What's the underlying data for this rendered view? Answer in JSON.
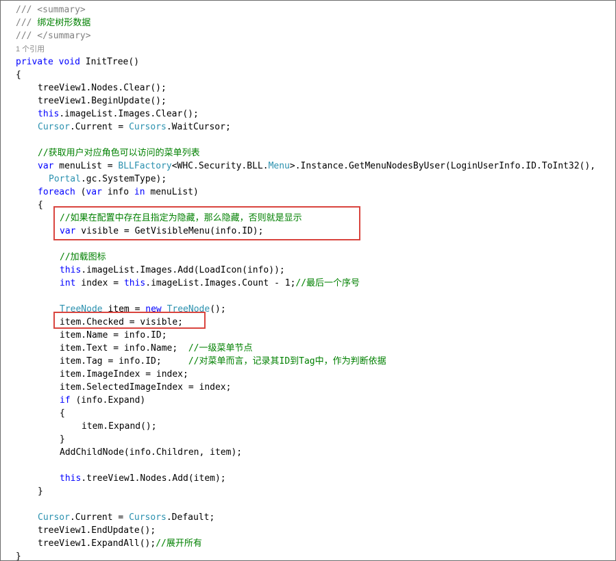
{
  "editor": {
    "lines": [
      {
        "indent": 0,
        "tokens": [
          {
            "t": "/// <summary>",
            "c": "gray"
          }
        ]
      },
      {
        "indent": 0,
        "tokens": [
          {
            "t": "/// ",
            "c": "gray"
          },
          {
            "t": "绑定树形数据",
            "c": "green"
          }
        ]
      },
      {
        "indent": 0,
        "tokens": [
          {
            "t": "/// </summary>",
            "c": "gray"
          }
        ]
      },
      {
        "indent": 0,
        "lens": true,
        "tokens": [
          {
            "t": "1 个引用",
            "c": "lens"
          }
        ]
      },
      {
        "indent": 0,
        "tokens": [
          {
            "t": "private",
            "c": "kw"
          },
          {
            "t": " ",
            "c": "black"
          },
          {
            "t": "void",
            "c": "kw"
          },
          {
            "t": " InitTree()",
            "c": "black"
          }
        ]
      },
      {
        "indent": 0,
        "tokens": [
          {
            "t": "{",
            "c": "black"
          }
        ]
      },
      {
        "indent": 1,
        "tokens": [
          {
            "t": "treeView1.Nodes.Clear();",
            "c": "black"
          }
        ]
      },
      {
        "indent": 1,
        "tokens": [
          {
            "t": "treeView1.BeginUpdate();",
            "c": "black"
          }
        ]
      },
      {
        "indent": 1,
        "tokens": [
          {
            "t": "this",
            "c": "kw"
          },
          {
            "t": ".imageList.Images.Clear();",
            "c": "black"
          }
        ]
      },
      {
        "indent": 1,
        "tokens": [
          {
            "t": "Cursor",
            "c": "type"
          },
          {
            "t": ".Current = ",
            "c": "black"
          },
          {
            "t": "Cursors",
            "c": "type"
          },
          {
            "t": ".WaitCursor;",
            "c": "black"
          }
        ]
      },
      {
        "indent": 0,
        "tokens": []
      },
      {
        "indent": 1,
        "tokens": [
          {
            "t": "//获取用户对应角色可以访问的菜单列表",
            "c": "green"
          }
        ]
      },
      {
        "indent": 1,
        "tokens": [
          {
            "t": "var",
            "c": "kw"
          },
          {
            "t": " menuList = ",
            "c": "black"
          },
          {
            "t": "BLLFactory",
            "c": "type"
          },
          {
            "t": "<WHC.Security.BLL.",
            "c": "black"
          },
          {
            "t": "Menu",
            "c": "type"
          },
          {
            "t": ">.Instance.GetMenuNodesByUser(LoginUserInfo.ID.ToInt32(),",
            "c": "black"
          }
        ]
      },
      {
        "indent": 1,
        "extra": 2,
        "tokens": [
          {
            "t": "Portal",
            "c": "type"
          },
          {
            "t": ".gc.SystemType);",
            "c": "black"
          }
        ]
      },
      {
        "indent": 1,
        "tokens": [
          {
            "t": "foreach",
            "c": "kw"
          },
          {
            "t": " (",
            "c": "black"
          },
          {
            "t": "var",
            "c": "kw"
          },
          {
            "t": " info ",
            "c": "black"
          },
          {
            "t": "in",
            "c": "kw"
          },
          {
            "t": " menuList)",
            "c": "black"
          }
        ]
      },
      {
        "indent": 1,
        "tokens": [
          {
            "t": "{",
            "c": "black"
          }
        ]
      },
      {
        "indent": 2,
        "tokens": [
          {
            "t": "//如果在配置中存在且指定为隐藏，那么隐藏，否则就是显示",
            "c": "green"
          }
        ]
      },
      {
        "indent": 2,
        "tokens": [
          {
            "t": "var",
            "c": "kw"
          },
          {
            "t": " visible = GetVisibleMenu(info.ID);",
            "c": "black"
          }
        ]
      },
      {
        "indent": 0,
        "tokens": []
      },
      {
        "indent": 2,
        "tokens": [
          {
            "t": "//加载图标",
            "c": "green"
          }
        ]
      },
      {
        "indent": 2,
        "tokens": [
          {
            "t": "this",
            "c": "kw"
          },
          {
            "t": ".imageList.Images.Add(LoadIcon(info));",
            "c": "black"
          }
        ]
      },
      {
        "indent": 2,
        "tokens": [
          {
            "t": "int",
            "c": "kw"
          },
          {
            "t": " index = ",
            "c": "black"
          },
          {
            "t": "this",
            "c": "kw"
          },
          {
            "t": ".imageList.Images.Count - 1;",
            "c": "black"
          },
          {
            "t": "//最后一个序号",
            "c": "green"
          }
        ]
      },
      {
        "indent": 0,
        "tokens": []
      },
      {
        "indent": 2,
        "tokens": [
          {
            "t": "TreeNode",
            "c": "type"
          },
          {
            "t": " item = ",
            "c": "black"
          },
          {
            "t": "new",
            "c": "kw"
          },
          {
            "t": " ",
            "c": "black"
          },
          {
            "t": "TreeNode",
            "c": "type"
          },
          {
            "t": "();",
            "c": "black"
          }
        ]
      },
      {
        "indent": 2,
        "tokens": [
          {
            "t": "item.Checked = visible;",
            "c": "black"
          }
        ]
      },
      {
        "indent": 2,
        "tokens": [
          {
            "t": "item.Name = info.ID;",
            "c": "black"
          }
        ]
      },
      {
        "indent": 2,
        "tokens": [
          {
            "t": "item.Text = info.Name;  ",
            "c": "black"
          },
          {
            "t": "//一级菜单节点",
            "c": "green"
          }
        ]
      },
      {
        "indent": 2,
        "tokens": [
          {
            "t": "item.Tag = info.ID;     ",
            "c": "black"
          },
          {
            "t": "//对菜单而言，记录其ID到Tag中，作为判断依据",
            "c": "green"
          }
        ]
      },
      {
        "indent": 2,
        "tokens": [
          {
            "t": "item.ImageIndex = index;",
            "c": "black"
          }
        ]
      },
      {
        "indent": 2,
        "tokens": [
          {
            "t": "item.SelectedImageIndex = index;",
            "c": "black"
          }
        ]
      },
      {
        "indent": 2,
        "tokens": [
          {
            "t": "if",
            "c": "kw"
          },
          {
            "t": " (info.Expand)",
            "c": "black"
          }
        ]
      },
      {
        "indent": 2,
        "tokens": [
          {
            "t": "{",
            "c": "black"
          }
        ]
      },
      {
        "indent": 3,
        "tokens": [
          {
            "t": "item.Expand();",
            "c": "black"
          }
        ]
      },
      {
        "indent": 2,
        "tokens": [
          {
            "t": "}",
            "c": "black"
          }
        ]
      },
      {
        "indent": 2,
        "tokens": [
          {
            "t": "AddChildNode(info.Children, item);",
            "c": "black"
          }
        ]
      },
      {
        "indent": 0,
        "tokens": []
      },
      {
        "indent": 2,
        "tokens": [
          {
            "t": "this",
            "c": "kw"
          },
          {
            "t": ".treeView1.Nodes.Add(item);",
            "c": "black"
          }
        ]
      },
      {
        "indent": 1,
        "tokens": [
          {
            "t": "}",
            "c": "black"
          }
        ]
      },
      {
        "indent": 0,
        "tokens": []
      },
      {
        "indent": 1,
        "tokens": [
          {
            "t": "Cursor",
            "c": "type"
          },
          {
            "t": ".Current = ",
            "c": "black"
          },
          {
            "t": "Cursors",
            "c": "type"
          },
          {
            "t": ".Default;",
            "c": "black"
          }
        ]
      },
      {
        "indent": 1,
        "tokens": [
          {
            "t": "treeView1.EndUpdate();",
            "c": "black"
          }
        ]
      },
      {
        "indent": 1,
        "tokens": [
          {
            "t": "treeView1.ExpandAll();",
            "c": "black"
          },
          {
            "t": "//展开所有",
            "c": "green"
          }
        ]
      },
      {
        "indent": 0,
        "tokens": [
          {
            "t": "}",
            "c": "black"
          }
        ]
      }
    ]
  },
  "colors": {
    "comment_doc": "#808080",
    "comment": "#008000",
    "keyword": "#0000ff",
    "type": "#2b91af",
    "highlight_border": "#d9443e"
  }
}
